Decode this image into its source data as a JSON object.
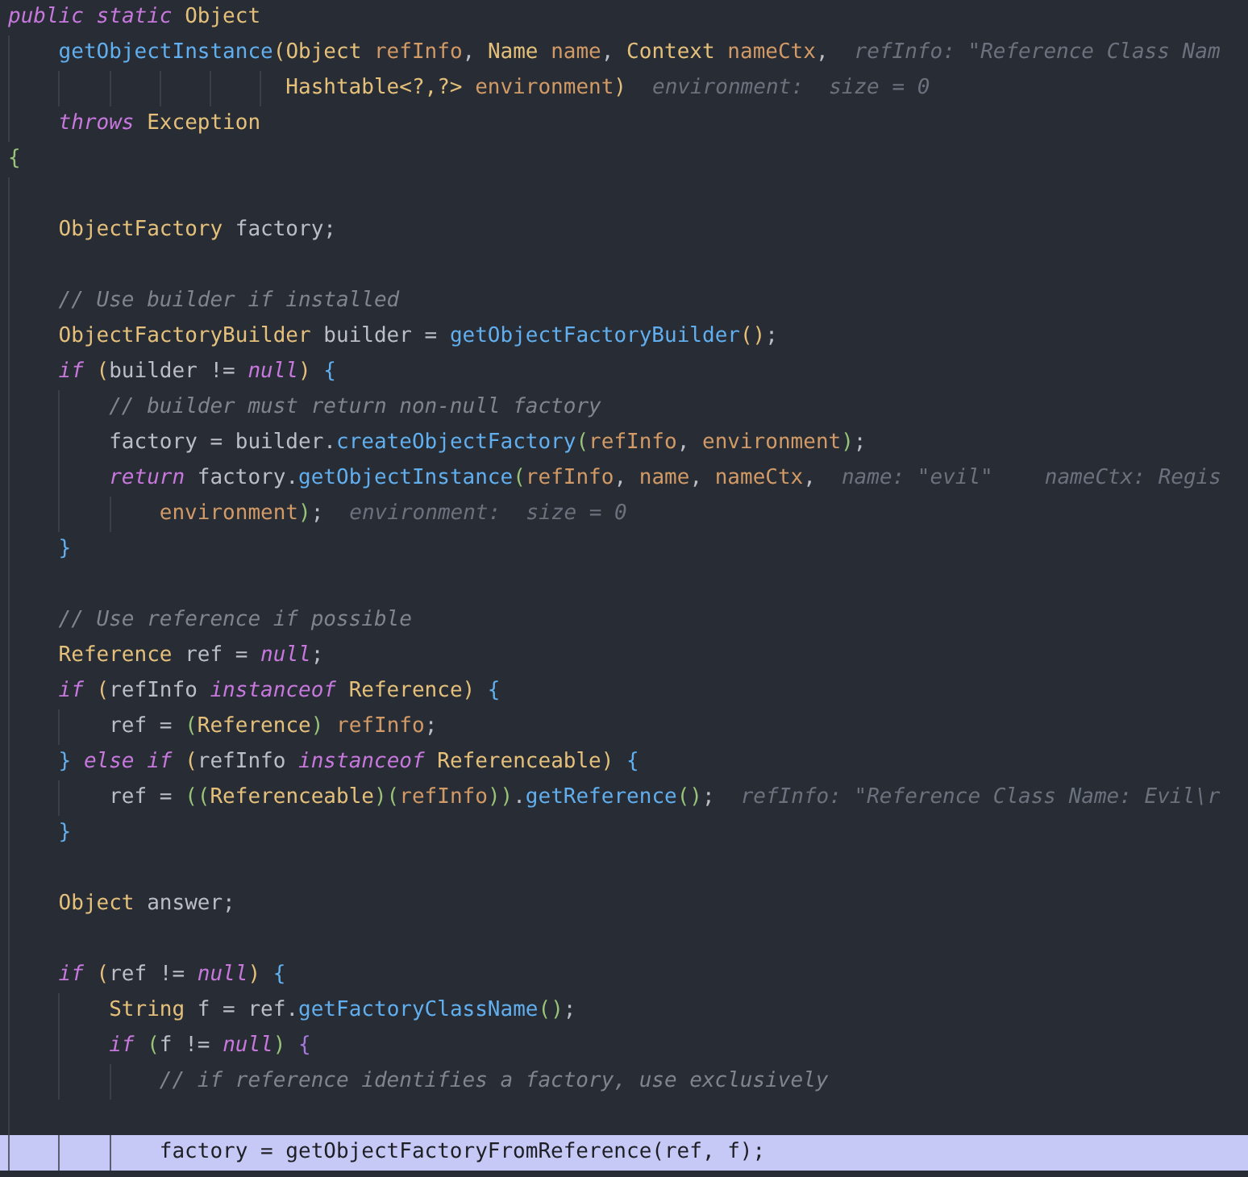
{
  "editor": {
    "lines": [
      {
        "highlighted": false,
        "tokens": [
          {
            "kind": "kw",
            "text": "public static "
          },
          {
            "kind": "type",
            "text": "Object"
          }
        ]
      },
      {
        "highlighted": false,
        "tokens": [
          {
            "kind": "fn",
            "text": "    getObjectInstance"
          },
          {
            "kind": "b1",
            "text": "("
          },
          {
            "kind": "type",
            "text": "Object "
          },
          {
            "kind": "param",
            "text": "refInfo"
          },
          {
            "kind": "plain",
            "text": ", "
          },
          {
            "kind": "type",
            "text": "Name "
          },
          {
            "kind": "param",
            "text": "name"
          },
          {
            "kind": "plain",
            "text": ", "
          },
          {
            "kind": "type",
            "text": "Context "
          },
          {
            "kind": "param",
            "text": "nameCtx"
          },
          {
            "kind": "plain",
            "text": ","
          }
        ],
        "hints": [
          "refInfo: \"Reference Class Nam"
        ]
      },
      {
        "highlighted": false,
        "tokens": [
          {
            "kind": "type",
            "text": "                      Hashtable<?,?> "
          },
          {
            "kind": "param",
            "text": "environment"
          },
          {
            "kind": "b1",
            "text": ")"
          }
        ],
        "hints": [
          "environment:  size = 0"
        ]
      },
      {
        "highlighted": false,
        "tokens": [
          {
            "kind": "kw",
            "text": "    throws "
          },
          {
            "kind": "type",
            "text": "Exception"
          }
        ]
      },
      {
        "highlighted": false,
        "tokens": [
          {
            "kind": "b4",
            "text": "{"
          }
        ]
      },
      {
        "highlighted": false
      },
      {
        "highlighted": false,
        "tokens": [
          {
            "kind": "type",
            "text": "    ObjectFactory "
          },
          {
            "kind": "plain",
            "text": "factory;"
          }
        ]
      },
      {
        "highlighted": false
      },
      {
        "highlighted": false,
        "tokens": [
          {
            "kind": "comment",
            "text": "    // Use builder if installed"
          }
        ]
      },
      {
        "highlighted": false,
        "tokens": [
          {
            "kind": "type",
            "text": "    ObjectFactoryBuilder "
          },
          {
            "kind": "plain",
            "text": "builder = "
          },
          {
            "kind": "fn",
            "text": "getObjectFactoryBuilder"
          },
          {
            "kind": "b1",
            "text": "()"
          },
          {
            "kind": "plain",
            "text": ";"
          }
        ]
      },
      {
        "highlighted": false,
        "tokens": [
          {
            "kind": "kw",
            "text": "    if "
          },
          {
            "kind": "b1",
            "text": "("
          },
          {
            "kind": "plain",
            "text": "builder != "
          },
          {
            "kind": "kw",
            "text": "null"
          },
          {
            "kind": "b1",
            "text": ")"
          },
          {
            "kind": "b3",
            "text": " {"
          }
        ]
      },
      {
        "highlighted": false,
        "tokens": [
          {
            "kind": "comment",
            "text": "        // builder must return non-null factory"
          }
        ]
      },
      {
        "highlighted": false,
        "tokens": [
          {
            "kind": "plain",
            "text": "        factory = builder."
          },
          {
            "kind": "fn",
            "text": "createObjectFactory"
          },
          {
            "kind": "b4",
            "text": "("
          },
          {
            "kind": "param",
            "text": "refInfo"
          },
          {
            "kind": "plain",
            "text": ", "
          },
          {
            "kind": "param",
            "text": "environment"
          },
          {
            "kind": "b4",
            "text": ")"
          },
          {
            "kind": "plain",
            "text": ";"
          }
        ]
      },
      {
        "highlighted": false,
        "tokens": [
          {
            "kind": "kw",
            "text": "        return "
          },
          {
            "kind": "plain",
            "text": "factory."
          },
          {
            "kind": "fn",
            "text": "getObjectInstance"
          },
          {
            "kind": "b4",
            "text": "("
          },
          {
            "kind": "param",
            "text": "refInfo"
          },
          {
            "kind": "plain",
            "text": ", "
          },
          {
            "kind": "param",
            "text": "name"
          },
          {
            "kind": "plain",
            "text": ", "
          },
          {
            "kind": "param",
            "text": "nameCtx"
          },
          {
            "kind": "plain",
            "text": ","
          }
        ],
        "hints": [
          "name: \"evil\"",
          "nameCtx: Regis"
        ]
      },
      {
        "highlighted": false,
        "tokens": [
          {
            "kind": "param",
            "text": "            environment"
          },
          {
            "kind": "b4",
            "text": ")"
          },
          {
            "kind": "plain",
            "text": ";"
          }
        ],
        "hints": [
          "environment:  size = 0"
        ]
      },
      {
        "highlighted": false,
        "tokens": [
          {
            "kind": "b3",
            "text": "    }"
          }
        ]
      },
      {
        "highlighted": false
      },
      {
        "highlighted": false,
        "tokens": [
          {
            "kind": "comment",
            "text": "    // Use reference if possible"
          }
        ]
      },
      {
        "highlighted": false,
        "tokens": [
          {
            "kind": "type",
            "text": "    Reference "
          },
          {
            "kind": "plain",
            "text": "ref = "
          },
          {
            "kind": "kw",
            "text": "null"
          },
          {
            "kind": "plain",
            "text": ";"
          }
        ]
      },
      {
        "highlighted": false,
        "tokens": [
          {
            "kind": "kw",
            "text": "    if "
          },
          {
            "kind": "b1",
            "text": "("
          },
          {
            "kind": "plain",
            "text": "refInfo "
          },
          {
            "kind": "kw",
            "text": "instanceof "
          },
          {
            "kind": "type",
            "text": "Reference"
          },
          {
            "kind": "b1",
            "text": ")"
          },
          {
            "kind": "b3",
            "text": " {"
          }
        ]
      },
      {
        "highlighted": false,
        "tokens": [
          {
            "kind": "plain",
            "text": "        ref = "
          },
          {
            "kind": "b4",
            "text": "("
          },
          {
            "kind": "type",
            "text": "Reference"
          },
          {
            "kind": "b4",
            "text": ")"
          },
          {
            "kind": "param",
            "text": " refInfo"
          },
          {
            "kind": "plain",
            "text": ";"
          }
        ]
      },
      {
        "highlighted": false,
        "tokens": [
          {
            "kind": "b3",
            "text": "    }"
          },
          {
            "kind": "kw",
            "text": " else if "
          },
          {
            "kind": "b1",
            "text": "("
          },
          {
            "kind": "plain",
            "text": "refInfo "
          },
          {
            "kind": "kw",
            "text": "instanceof "
          },
          {
            "kind": "type",
            "text": "Referenceable"
          },
          {
            "kind": "b1",
            "text": ")"
          },
          {
            "kind": "b3",
            "text": " {"
          }
        ]
      },
      {
        "highlighted": false,
        "tokens": [
          {
            "kind": "plain",
            "text": "        ref = "
          },
          {
            "kind": "b4",
            "text": "(("
          },
          {
            "kind": "type",
            "text": "Referenceable"
          },
          {
            "kind": "b4",
            "text": ")("
          },
          {
            "kind": "param",
            "text": "refInfo"
          },
          {
            "kind": "b4",
            "text": "))"
          },
          {
            "kind": "plain",
            "text": "."
          },
          {
            "kind": "fn",
            "text": "getReference"
          },
          {
            "kind": "b4",
            "text": "()"
          },
          {
            "kind": "plain",
            "text": ";"
          }
        ],
        "hints": [
          "refInfo: \"Reference Class Name: Evil\\r"
        ]
      },
      {
        "highlighted": false,
        "tokens": [
          {
            "kind": "b3",
            "text": "    }"
          }
        ]
      },
      {
        "highlighted": false
      },
      {
        "highlighted": false,
        "tokens": [
          {
            "kind": "type",
            "text": "    Object "
          },
          {
            "kind": "plain",
            "text": "answer;"
          }
        ]
      },
      {
        "highlighted": false
      },
      {
        "highlighted": false,
        "tokens": [
          {
            "kind": "kw",
            "text": "    if "
          },
          {
            "kind": "b1",
            "text": "("
          },
          {
            "kind": "plain",
            "text": "ref != "
          },
          {
            "kind": "kw",
            "text": "null"
          },
          {
            "kind": "b1",
            "text": ")"
          },
          {
            "kind": "b3",
            "text": " {"
          }
        ]
      },
      {
        "highlighted": false,
        "tokens": [
          {
            "kind": "type",
            "text": "        String "
          },
          {
            "kind": "plain",
            "text": "f = ref."
          },
          {
            "kind": "fn",
            "text": "getFactoryClassName"
          },
          {
            "kind": "b4",
            "text": "()"
          },
          {
            "kind": "plain",
            "text": ";"
          }
        ]
      },
      {
        "highlighted": false,
        "tokens": [
          {
            "kind": "kw",
            "text": "        if "
          },
          {
            "kind": "b4",
            "text": "("
          },
          {
            "kind": "plain",
            "text": "f != "
          },
          {
            "kind": "kw",
            "text": "null"
          },
          {
            "kind": "b4",
            "text": ")"
          },
          {
            "kind": "b2",
            "text": " {"
          }
        ]
      },
      {
        "highlighted": false,
        "tokens": [
          {
            "kind": "comment",
            "text": "            // if reference identifies a factory, use exclusively"
          }
        ]
      },
      {
        "highlighted": false
      },
      {
        "highlighted": true,
        "tokens": [
          {
            "kind": "plain",
            "text": "            factory = getObjectFactoryFromReference(ref, f);"
          }
        ]
      }
    ]
  }
}
